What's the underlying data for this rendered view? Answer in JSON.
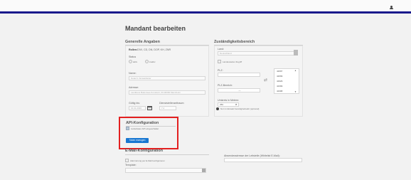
{
  "header": {
    "user_icon": "user-icon",
    "accent": "#1a1a8c"
  },
  "page": {
    "title": "Mandant bearbeiten"
  },
  "general": {
    "heading": "Generelle Angaben",
    "roles_label": "Rollen:",
    "roles_value": "DIVI, CD, DN, DOP, KH, ZNR",
    "status_label": "Status",
    "status_option_active": "aktiv",
    "status_option_inactive": "inaktiv",
    "name_label": "Name:",
    "name_placeholder": "Notarzt / Einsatzleiter",
    "address_label": "Adresse:",
    "address_placeholder": "Landkreis Bodensee-Konstanz, 00-00000 Mannheim",
    "valid_until_label": "Gültig bis:",
    "valid_until_placeholder": "01.01.2030",
    "dist_label": "Dienststellenzeitraum:",
    "dist_placeholder": "7 d"
  },
  "responsibility": {
    "heading": "Zuständigkeitsbereich",
    "country_label": "Land:",
    "country_value": "Deutschland",
    "nationwide_label": "Landesweiter Zugriff",
    "plz_label": "PLZ:",
    "plz_range_label": "PLZ-Bereich:",
    "plz_range_value": "—",
    "plz_list": [
      "42697",
      "42699",
      "42929",
      "42399",
      "42398"
    ],
    "radius_label": "Umkreis in Metern:",
    "radius_value": "250",
    "radius_hint": "Nur im Einsatz benötigt/erlaubt (optional)"
  },
  "api": {
    "heading": "API-Konfiguration",
    "checkbox_label": "Lieferdaten API eingeschaltet",
    "button_label": "Token erzeugen"
  },
  "email": {
    "heading": "E-Mail-Konfiguration",
    "checkbox_label": "Alarmierung per E-Mail konfigurieren",
    "template_label": "Template:",
    "sender_label": "Absenderadresse der Leitstelle (Whitelist E-Mail):"
  }
}
